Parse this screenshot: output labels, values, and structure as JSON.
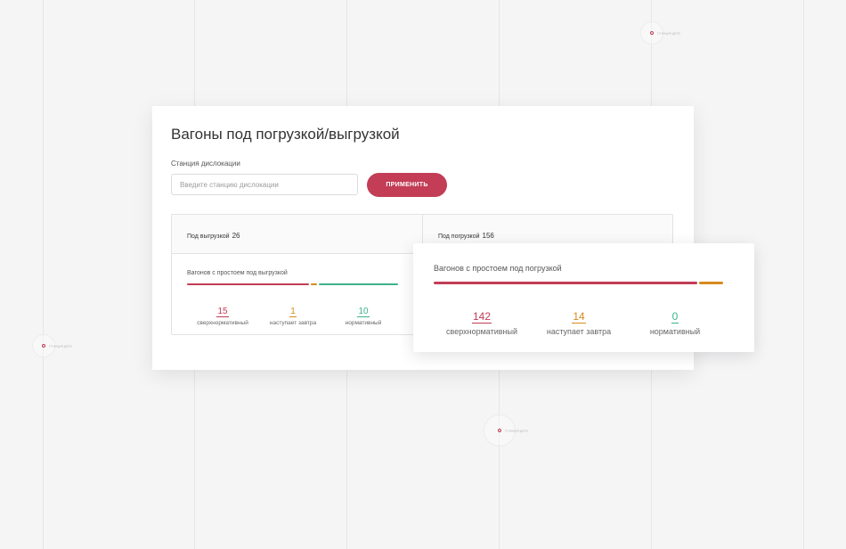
{
  "background": {
    "markers": [
      {
        "label": "Станция депо"
      },
      {
        "label": "Станция депо"
      },
      {
        "label": "Станция депо"
      }
    ]
  },
  "card": {
    "title": "Вагоны под погрузкой/выгрузкой",
    "station_label": "Станция дислокации",
    "station_placeholder": "Введите станцию дислокации",
    "station_value": "",
    "apply_label": "ПРИМЕНИТЬ"
  },
  "tabs": {
    "unload": {
      "label": "Под выгрузкой",
      "count": "26"
    },
    "load": {
      "label": "Под погрузкой",
      "count": "156"
    }
  },
  "unload_stats": {
    "title": "Вагонов с простоем под выгрузкой",
    "items": [
      {
        "value": "15",
        "label": "сверхнормативный"
      },
      {
        "value": "1",
        "label": "наступает завтра"
      },
      {
        "value": "10",
        "label": "нормативный"
      }
    ]
  },
  "load_stats": {
    "title": "Вагонов с простоем под погрузкой",
    "items": [
      {
        "value": "142",
        "label": "сверхнормативный"
      },
      {
        "value": "14",
        "label": "наступает завтра"
      },
      {
        "value": "0",
        "label": "нормативный"
      }
    ]
  },
  "colors": {
    "accent": "#c23d55",
    "over_norm": "#c23d55",
    "tomorrow": "#d68a1e",
    "normal": "#3db38a"
  }
}
